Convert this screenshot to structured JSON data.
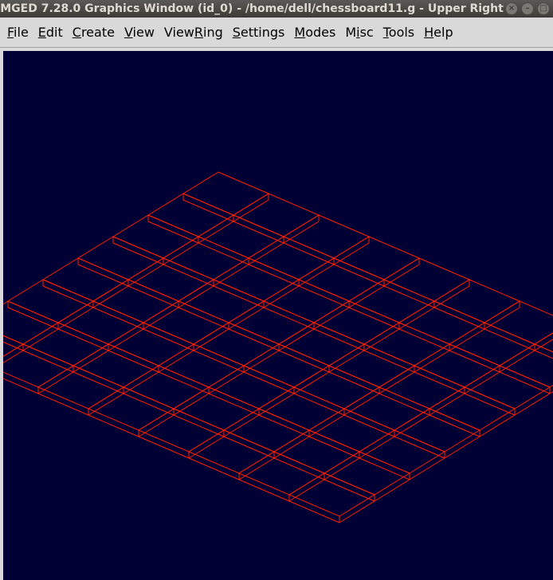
{
  "window": {
    "title": "MGED 7.28.0 Graphics Window (id_0) - /home/dell/chessboard11.g - Upper Right",
    "buttons": [
      "close",
      "minimize",
      "maximize"
    ]
  },
  "menu": {
    "items": [
      {
        "label": "File",
        "mnemonic": 0
      },
      {
        "label": "Edit",
        "mnemonic": 0
      },
      {
        "label": "Create",
        "mnemonic": 0
      },
      {
        "label": "View",
        "mnemonic": 0
      },
      {
        "label": "ViewRing",
        "mnemonic": 4
      },
      {
        "label": "Settings",
        "mnemonic": 0
      },
      {
        "label": "Modes",
        "mnemonic": 0
      },
      {
        "label": "Misc",
        "mnemonic": 1
      },
      {
        "label": "Tools",
        "mnemonic": 0
      },
      {
        "label": "Help",
        "mnemonic": 0
      }
    ]
  },
  "viewport": {
    "background_color": "#000034",
    "wireframe_color": "#ff2200",
    "scene": "chessboard wireframe, 8x8 checkerboard of square tiles in isometric view"
  }
}
